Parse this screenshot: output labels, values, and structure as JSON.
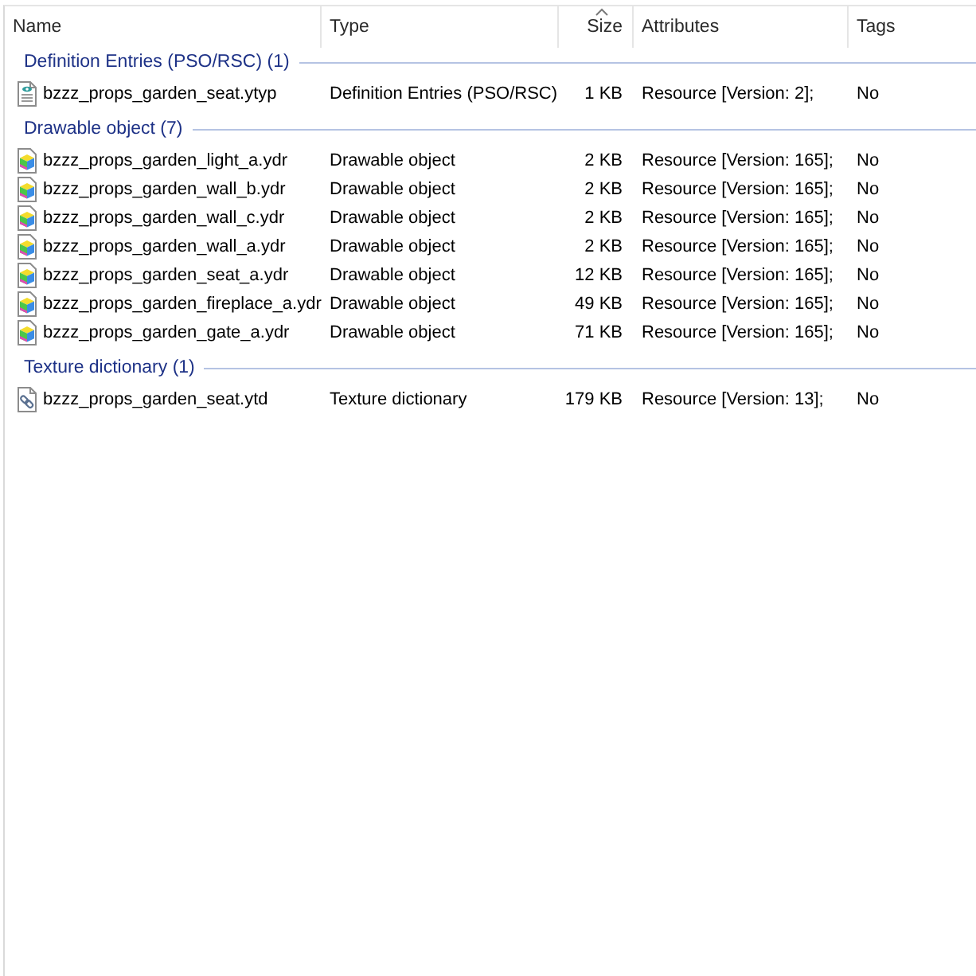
{
  "columns": [
    {
      "label": "Name",
      "sorted": false
    },
    {
      "label": "Type",
      "sorted": false
    },
    {
      "label": "Size",
      "sorted": true
    },
    {
      "label": "Attributes",
      "sorted": false
    },
    {
      "label": "Tags",
      "sorted": false
    }
  ],
  "groups": [
    {
      "label": "Definition Entries (PSO/RSC) (1)",
      "rows": [
        {
          "kind": "definition",
          "name": "bzzz_props_garden_seat.ytyp",
          "type": "Definition Entries (PSO/RSC)",
          "size": "1 KB",
          "attributes": "Resource [Version: 2];",
          "tags": "No"
        }
      ]
    },
    {
      "label": "Drawable object (7)",
      "rows": [
        {
          "kind": "drawable",
          "name": "bzzz_props_garden_light_a.ydr",
          "type": "Drawable object",
          "size": "2 KB",
          "attributes": "Resource [Version: 165];",
          "tags": "No"
        },
        {
          "kind": "drawable",
          "name": "bzzz_props_garden_wall_b.ydr",
          "type": "Drawable object",
          "size": "2 KB",
          "attributes": "Resource [Version: 165];",
          "tags": "No"
        },
        {
          "kind": "drawable",
          "name": "bzzz_props_garden_wall_c.ydr",
          "type": "Drawable object",
          "size": "2 KB",
          "attributes": "Resource [Version: 165];",
          "tags": "No"
        },
        {
          "kind": "drawable",
          "name": "bzzz_props_garden_wall_a.ydr",
          "type": "Drawable object",
          "size": "2 KB",
          "attributes": "Resource [Version: 165];",
          "tags": "No"
        },
        {
          "kind": "drawable",
          "name": "bzzz_props_garden_seat_a.ydr",
          "type": "Drawable object",
          "size": "12 KB",
          "attributes": "Resource [Version: 165];",
          "tags": "No"
        },
        {
          "kind": "drawable",
          "name": "bzzz_props_garden_fireplace_a.ydr",
          "type": "Drawable object",
          "size": "49 KB",
          "attributes": "Resource [Version: 165];",
          "tags": "No"
        },
        {
          "kind": "drawable",
          "name": "bzzz_props_garden_gate_a.ydr",
          "type": "Drawable object",
          "size": "71 KB",
          "attributes": "Resource [Version: 165];",
          "tags": "No"
        }
      ]
    },
    {
      "label": "Texture dictionary (1)",
      "rows": [
        {
          "kind": "texture",
          "name": "bzzz_props_garden_seat.ytd",
          "type": "Texture dictionary",
          "size": "179 KB",
          "attributes": "Resource [Version: 13];",
          "tags": "No"
        }
      ]
    }
  ]
}
